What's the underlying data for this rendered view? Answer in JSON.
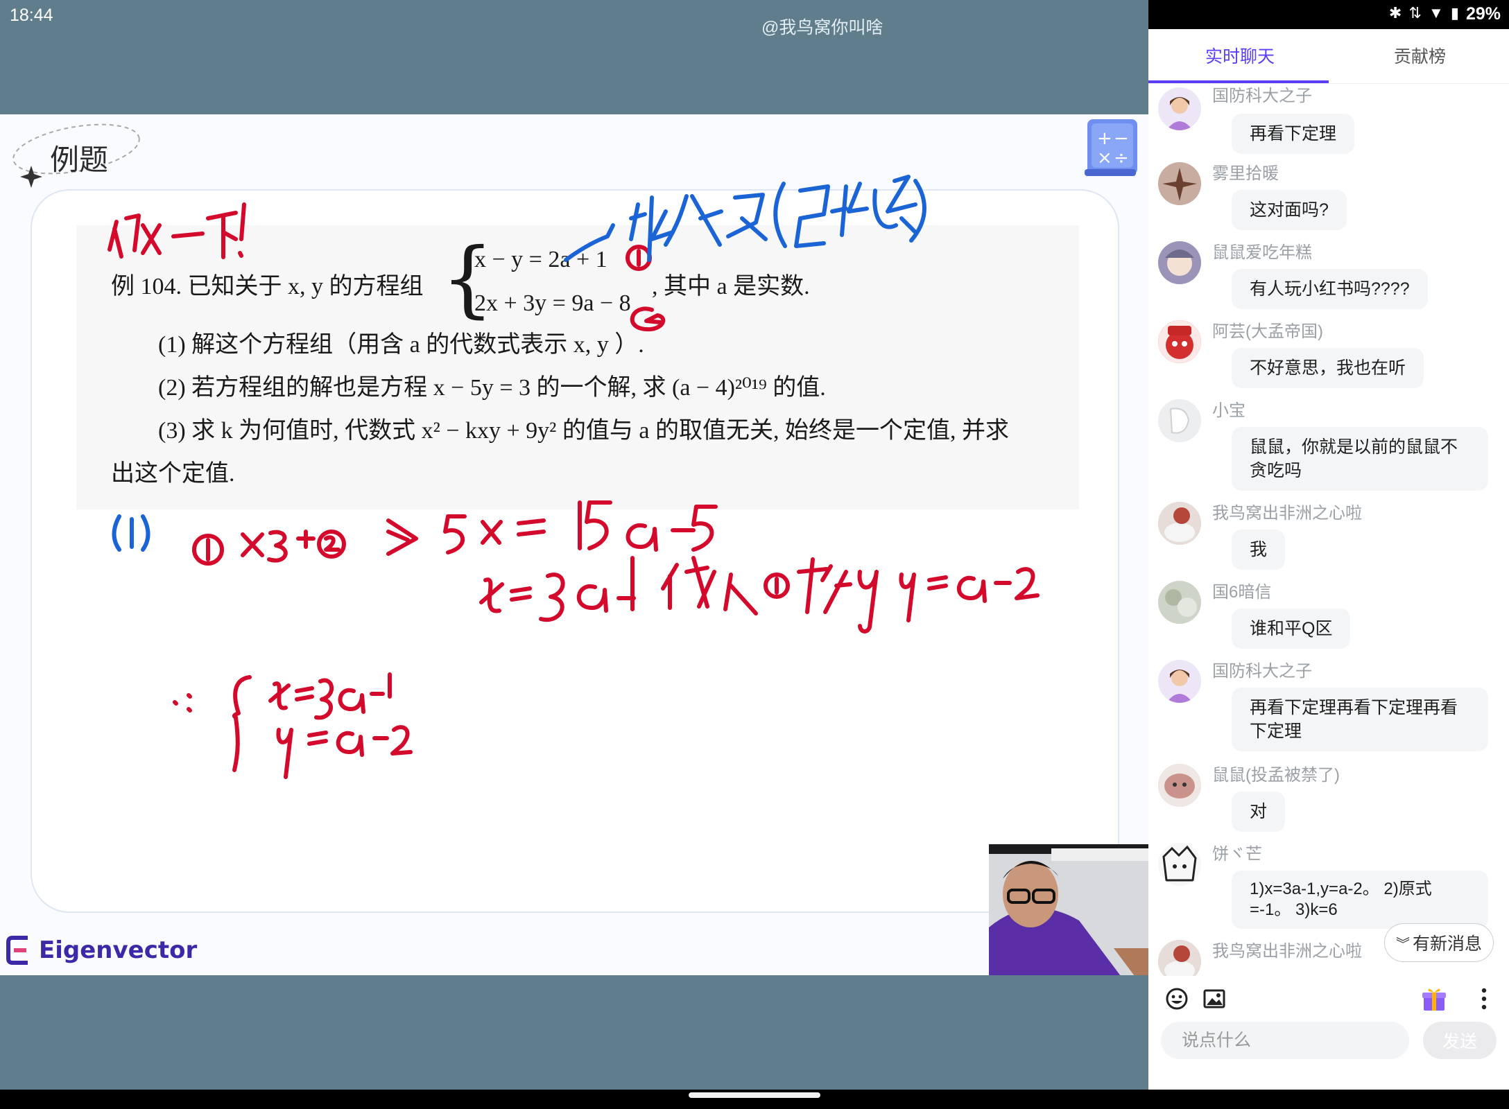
{
  "status_bar": {
    "time": "18:44",
    "battery": "29%"
  },
  "stream": {
    "watermark": "@我鸟窝你叫啥",
    "slide": {
      "badge_label": "例题",
      "brand": "Eigenvector",
      "problem": {
        "line1_prefix": "例 104. 已知关于 x, y 的方程组",
        "eq1": "x − y = 2a + 1",
        "eq2": "2x + 3y = 9a − 8",
        "line1_suffix": ", 其中 a 是实数.",
        "q1": "(1) 解这个方程组（用含 a 的代数式表示 x, y ）.",
        "q2": "(2) 若方程组的解也是方程 x − 5y = 3 的一个解, 求 (a − 4)²⁰¹⁹ 的值.",
        "q3a": "(3) 求 k 为何值时, 代数式 x² − kxy + 9y² 的值与 a 的取值无关, 始终是一个定值, 并求",
        "q3b": "出这个定值."
      }
    }
  },
  "chat_panel": {
    "tabs": [
      {
        "label": "实时聊天"
      },
      {
        "label": "贡献榜"
      }
    ],
    "messages": [
      {
        "user": "国防科大之子",
        "text": "再看下定理"
      },
      {
        "user": "雾里拾暖",
        "text": "这对面吗?"
      },
      {
        "user": "鼠鼠爱吃年糕",
        "text": "有人玩小红书吗????"
      },
      {
        "user": "阿芸(大孟帝国)",
        "text": "不好意思，我也在听"
      },
      {
        "user": "小宝",
        "text": "鼠鼠，你就是以前的鼠鼠不贪吃吗"
      },
      {
        "user": "我鸟窝出非洲之心啦",
        "text": "我"
      },
      {
        "user": "国6暗信",
        "text": "谁和平Q区"
      },
      {
        "user": "国防科大之子",
        "text": "再看下定理再看下定理再看下定理"
      },
      {
        "user": "鼠鼠(投孟被禁了)",
        "text": "对"
      },
      {
        "user": "饼ヾ芒",
        "text": "1)x=3a-1,y=a-2。 2)原式=-1。 3)k=6"
      },
      {
        "user": "我鸟窝出非洲之心啦",
        "text": ""
      }
    ],
    "new_messages_label": "有新消息",
    "input_placeholder": "说点什么",
    "send_label": "发送",
    "icons": [
      "emoji-icon",
      "image-icon",
      "gift-icon",
      "more-icon"
    ],
    "accent_color": "#5b3df5"
  }
}
